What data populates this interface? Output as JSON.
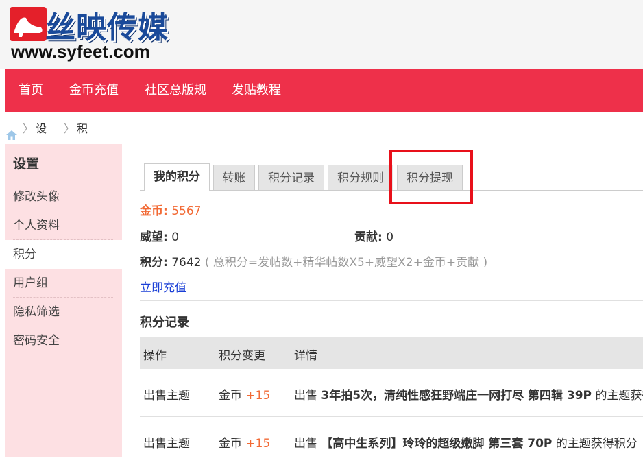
{
  "logo": {
    "name": "丝映传媒",
    "url": "www.syfeet.com"
  },
  "nav": [
    "首页",
    "金币充值",
    "社区总版规",
    "发贴教程"
  ],
  "breadcrumb": {
    "sep1": "〉",
    "item1": "设置",
    "sep2": "〉",
    "item2": "积分"
  },
  "sidebar": {
    "title": "设置",
    "items": [
      "修改头像",
      "个人资料",
      "积分",
      "用户组",
      "隐私筛选",
      "密码安全"
    ]
  },
  "tabs": [
    "我的积分",
    "转账",
    "积分记录",
    "积分规则",
    "积分提现"
  ],
  "stats": {
    "coins_label": "金币:",
    "coins_value": "5567",
    "prestige_label": "威望:",
    "prestige_value": "0",
    "contribution_label": "贡献:",
    "contribution_value": "0",
    "points_label": "积分:",
    "points_value": "7642",
    "points_formula": "( 总积分=发帖数+精华帖数X5+威望X2+金币+贡献 )",
    "recharge_link": "立即充值"
  },
  "records": {
    "title": "积分记录",
    "headers": [
      "操作",
      "积分变更",
      "详情"
    ],
    "rows": [
      {
        "action": "出售主题",
        "currency": "金币",
        "change": "+15",
        "detail_prefix": "出售",
        "detail_title": "3年拍5次，清纯性感狂野端庄一网打尽 第四辑 39P",
        "detail_suffix": "的主题获得积分"
      },
      {
        "action": "出售主题",
        "currency": "金币",
        "change": "+15",
        "detail_prefix": "出售",
        "detail_title": "【高中生系列】玲玲的超级嫩脚 第三套 70P",
        "detail_suffix": "的主题获得积分"
      }
    ]
  },
  "colors": {
    "nav_bg": "#ee304a",
    "sidebar_bg": "#fde0e3",
    "accent": "#f26a35",
    "link": "#1a3fd6",
    "highlight_box": "#e8101a"
  }
}
